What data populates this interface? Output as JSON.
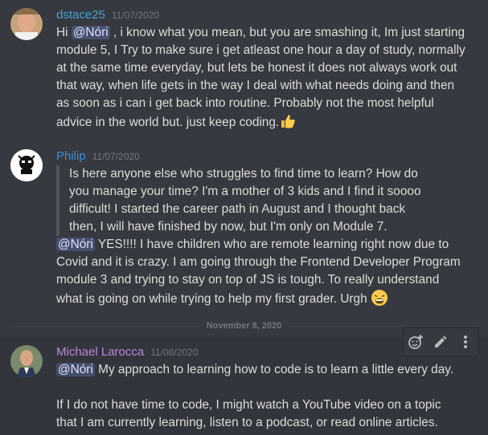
{
  "colors": {
    "background": "#36393f",
    "text": "#dcddde",
    "timestamp": "#72767d",
    "mention_bg": "rgba(114,137,218,0.3)",
    "author_dstace": "#46a4d6",
    "author_philip": "#3b8fe0",
    "author_michael": "#b98ad9"
  },
  "messages": [
    {
      "author": "dstace25",
      "timestamp": "11/07/2020",
      "lines": [
        [
          "Hi ",
          "@Nóri",
          " , i know what you mean, but you are smashing it, Im just starting"
        ],
        "module 5, I Try to make sure i get atleast one hour a day of study, normally",
        "at the same time everyday, but lets be honest it does not always work out",
        "that way, when life gets in the way I deal with what needs doing and then",
        "as soon as i can i get back into routine. Probably not the most helpful",
        "advice in the world but. just keep coding."
      ],
      "emoji": "thumbs-up-emoji"
    },
    {
      "author": "Philip",
      "timestamp": "11/07/2020",
      "quote_lines": [
        "Is here anyone else who struggles to find time to learn? How do",
        "you manage your time? I'm a mother of 3 kids and I find it soooo",
        "difficult! I started the career path in August and I thought back",
        "then, I will have finished by now, but I'm only on Module 7."
      ],
      "reply_mention": "@Nóri",
      "reply_lines": [
        " YES!!!! I have children who are remote learning right now due to",
        "Covid and it is crazy. I am going through the Frontend Developer Program",
        "module 3 and trying to stay on top of JS is tough.  To really understand",
        "what is going on while trying to help my first grader. Urgh"
      ],
      "emoji": "tired-face-emoji"
    },
    {
      "author": "Michael Larocca",
      "timestamp": "11/08/2020",
      "mention": "@Nóri",
      "first_line": " My approach to learning how to code is to learn a little every day.",
      "para2": [
        "If I do not have time to code, I might watch a YouTube video on a topic",
        "that I am currently learning, listen to a podcast, or read online articles."
      ]
    }
  ],
  "divider": "November 8, 2020",
  "toolbar": [
    "add-reaction-icon",
    "edit-icon",
    "more-options-icon"
  ]
}
